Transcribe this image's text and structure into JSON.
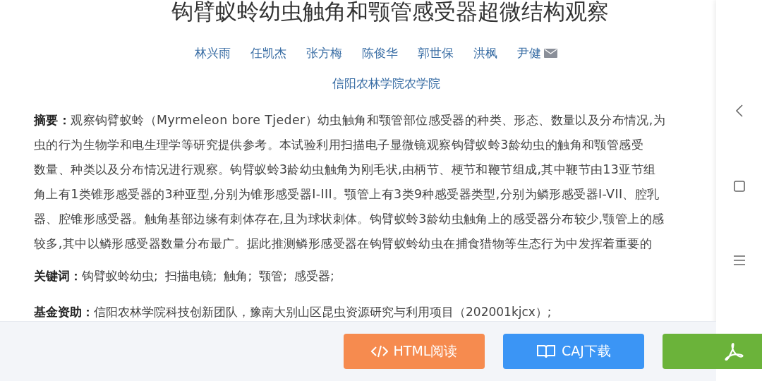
{
  "title": "钩臂蚁蛉幼虫触角和颚管感受器超微结构观察",
  "authors": [
    {
      "name": "林兴雨",
      "mail": false
    },
    {
      "name": "任凯杰",
      "mail": false
    },
    {
      "name": "张方梅",
      "mail": false
    },
    {
      "name": "陈俊华",
      "mail": false
    },
    {
      "name": "郭世保",
      "mail": false
    },
    {
      "name": "洪枫",
      "mail": false
    },
    {
      "name": "尹健",
      "mail": true
    }
  ],
  "affiliation": "信阳农林学院农学院",
  "abstract": {
    "label": "摘要：",
    "lines": [
      "观察钩臂蚁蛉（Myrmeleon bore Tjeder）幼虫触角和颚管部位感受器的种类、形态、数量以及分布情况,为",
      "虫的行为生物学和电生理学等研究提供参考。本试验利用扫描电子显微镜观察钩臂蚁蛉3龄幼虫的触角和颚管感受",
      "数量、种类以及分布情况进行观察。钩臂蚁蛉3龄幼虫触角为刚毛状,由柄节、梗节和鞭节组成,其中鞭节由13亚节组",
      "角上有1类锥形感受器的3种亚型,分别为锥形感受器I-III。颚管上有3类9种感受器类型,分别为鳞形感受器I-VII、腔乳",
      "器、腔锥形感受器。触角基部边缘有刺体存在,且为球状刺体。钩臂蚁蛉3龄幼虫触角上的感受器分布较少,颚管上的感",
      "较多,其中以鳞形感受器数量分布最广。据此推测鳞形感受器在钩臂蚁蛉幼虫在捕食猎物等生态行为中发挥着重要的"
    ]
  },
  "keywords": {
    "label": "关键词：",
    "items": [
      "钩臂蚁蛉幼虫;",
      "扫描电镜;",
      "触角;",
      "颚管;",
      "感受器;"
    ]
  },
  "funding": {
    "label": "基金资助：",
    "text": "信阳农林学院科技创新团队，豫南大别山区昆虫资源研究与利用项目（202001kjcx）;"
  },
  "buttons": [
    {
      "kind": "html",
      "label": "HTML阅读"
    },
    {
      "kind": "caj",
      "label": "CAJ下载"
    },
    {
      "kind": "pdf"
    }
  ]
}
